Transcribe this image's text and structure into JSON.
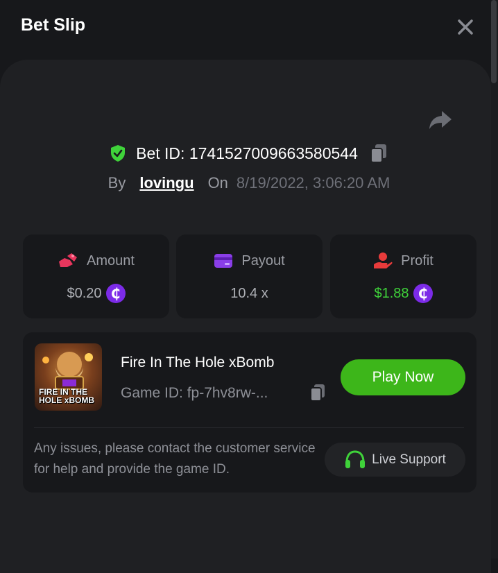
{
  "header": {
    "title": "Bet Slip"
  },
  "bet": {
    "id_label": "Bet ID: 1741527009663580544",
    "by_label": "By",
    "username": "lovingu",
    "on_label": "On",
    "date": "8/19/2022, 3:06:20 AM"
  },
  "stats": [
    {
      "label": "Amount",
      "value": "$0.20",
      "icon": "amount-icon",
      "color": "#e8365d"
    },
    {
      "label": "Payout",
      "value": "10.4 x",
      "icon": "card-icon",
      "color": "#8a3ee8"
    },
    {
      "label": "Profit",
      "value": "$1.88",
      "icon": "hand-coin-icon",
      "color": "#e83b3b"
    }
  ],
  "coin_symbol": "₵",
  "game": {
    "thumb_text": "FIRE IN THE HOLE xBOMB",
    "title": "Fire In The Hole xBomb",
    "id_label": "Game ID: fp-7hv8rw-...",
    "play_label": "Play Now"
  },
  "support": {
    "message": "Any issues, please contact the customer service for help and provide the game ID.",
    "button_label": "Live Support"
  },
  "colors": {
    "accent_green": "#3db61a",
    "coin_purple": "#7c2be8",
    "profit_green": "#3fd23a"
  }
}
